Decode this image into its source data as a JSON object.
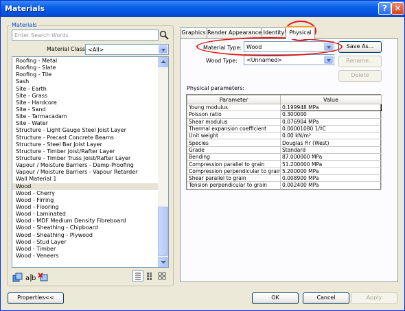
{
  "window": {
    "title": "Materials",
    "help_glyph": "?",
    "close_glyph": "✕"
  },
  "left": {
    "group_label": "Materials",
    "search_placeholder": "Enter Search Words",
    "class_label": "Material Class:",
    "class_value": "<All>",
    "items": [
      "Roofing - Metal",
      "Roofing - Slate",
      "Roofing - Tile",
      "Sash",
      "Site - Earth",
      "Site - Grass",
      "Site - Hardcore",
      "Site - Sand",
      "Site - Tarmacadam",
      "Site - Water",
      "Structure - Light Gauge Steel Joist Layer",
      "Structure - Precast Concrete Beams",
      "Structure - Steel Bar Joist Layer",
      "Structure - Timber Joist/Rafter Layer",
      "Structure - Timber Truss Joist/Rafter Layer",
      "Vapour / Moisture Barriers - Damp-Proofing",
      "Vapour / Moisture Barriers - Vapour Retarder",
      "Wall Material 1",
      "Wood",
      "Wood - Cherry",
      "Wood - Firring",
      "Wood - Flooring",
      "Wood - Laminated",
      "Wood - MDF Medium Density Fibreboard",
      "Wood - Sheathing - Chipboard",
      "Wood - Sheathing - Plywood",
      "Wood - Stud Layer",
      "Wood - Timber",
      "Wood - Veneers"
    ],
    "selected_item": "Wood"
  },
  "tabs": [
    {
      "label": "Graphics"
    },
    {
      "label": "Render Appearance"
    },
    {
      "label": "Identity"
    },
    {
      "label": "Physical"
    }
  ],
  "physical": {
    "material_type_label": "Material Type:",
    "material_type_value": "Wood",
    "wood_type_label": "Wood Type:",
    "wood_type_value": "<Unnamed>",
    "save_as_label": "Save As...",
    "rename_label": "Rename...",
    "delete_label": "Delete",
    "params_label": "Physical parameters:",
    "columns": [
      "Parameter",
      "Value"
    ],
    "rows": [
      [
        "Young modulus",
        "0.199948 MPa"
      ],
      [
        "Poisson ratio",
        "0.300000"
      ],
      [
        "Shear modulus",
        "0.076904 MPa"
      ],
      [
        "Thermal expansion coefficient",
        "0.00001080 1/ºC"
      ],
      [
        "Unit weight",
        "0.00 kN/m³"
      ],
      [
        "Species",
        "Douglas Fir (West)"
      ],
      [
        "Grade",
        "Standard"
      ],
      [
        "Bending",
        "87.000000 MPa"
      ],
      [
        "Compression parallel to grain",
        "51.200000 MPa"
      ],
      [
        "Compression perpendicular to grain",
        "5.200000 MPa"
      ],
      [
        "Shear parallel to grain",
        "0.008900 MPa"
      ],
      [
        "Tension perpendicular to grain",
        "0.002400 MPa"
      ]
    ]
  },
  "footer": {
    "properties_label": "Properties<<",
    "ok_label": "OK",
    "cancel_label": "Cancel",
    "apply_label": "Apply"
  },
  "colors": {
    "title_bar": "#0554e3",
    "highlight_ring": "#e01818",
    "active_tab_accent": "#f3a12c"
  }
}
